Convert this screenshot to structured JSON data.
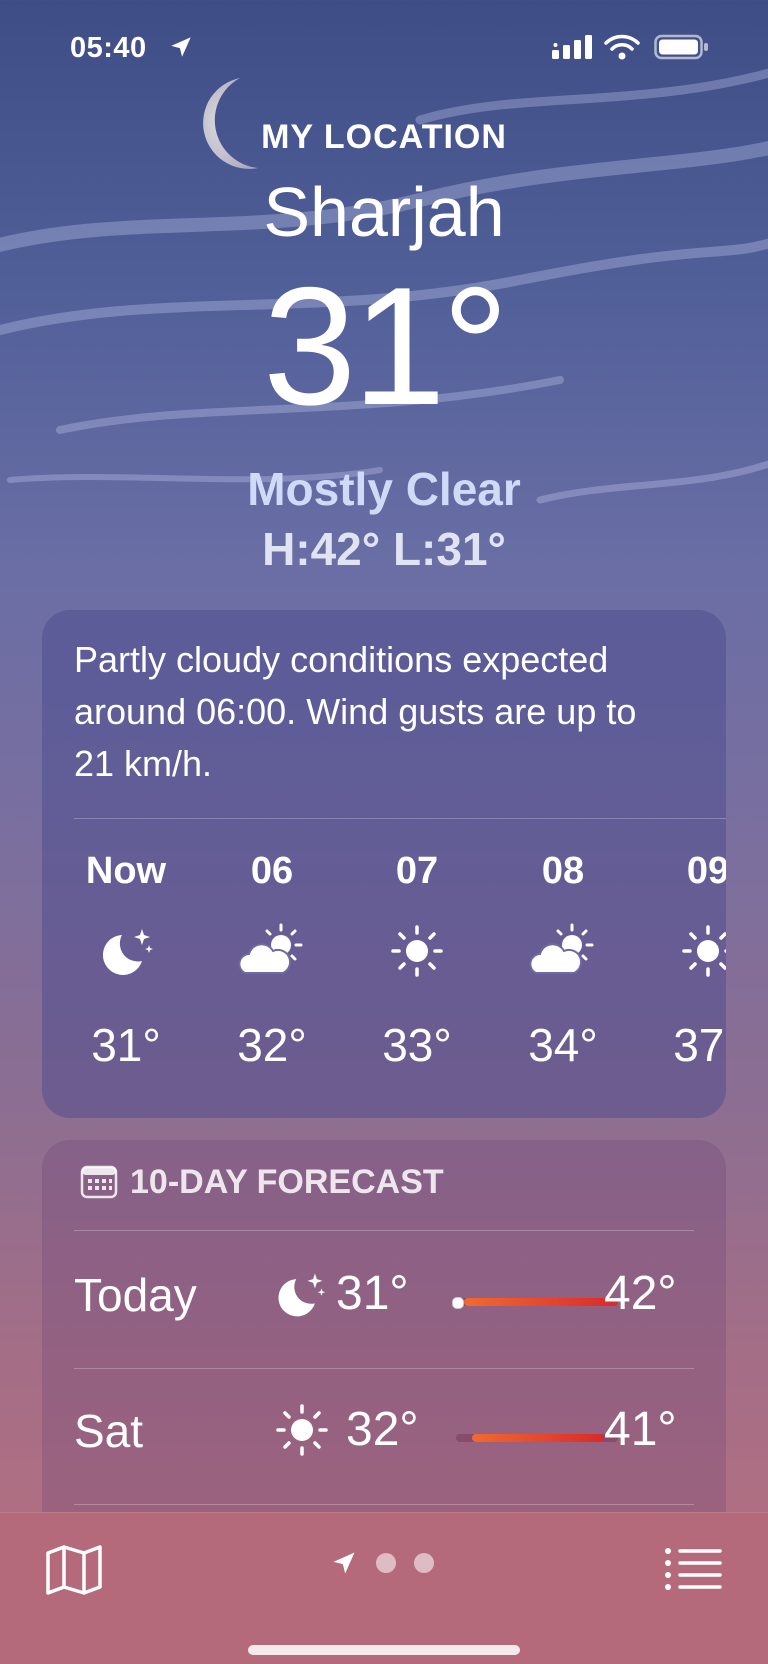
{
  "status_bar": {
    "time": "05:40"
  },
  "header": {
    "location_label": "MY LOCATION",
    "city": "Sharjah",
    "temperature": "31°",
    "condition": "Mostly Clear",
    "high_low": "H:42°  L:31°"
  },
  "hourly_card": {
    "summary": "Partly cloudy conditions expected around 06:00. Wind gusts are up to 21 km/h.",
    "hours": [
      {
        "label": "Now",
        "icon": "moon-stars-icon",
        "temp": "31°"
      },
      {
        "label": "06",
        "icon": "partly-cloudy-sun-icon",
        "temp": "32°"
      },
      {
        "label": "07",
        "icon": "sun-icon",
        "temp": "33°"
      },
      {
        "label": "08",
        "icon": "partly-cloudy-sun-icon",
        "temp": "34°"
      },
      {
        "label": "09",
        "icon": "sun-icon",
        "temp": "37°"
      }
    ]
  },
  "forecast_card": {
    "title": "10-DAY FORECAST",
    "days": [
      {
        "day": "Today",
        "icon": "moon-stars-icon",
        "low": "31°",
        "high": "42°"
      },
      {
        "day": "Sat",
        "icon": "sun-icon",
        "low": "32°",
        "high": "41°"
      }
    ]
  },
  "tab_bar": {
    "icons": [
      "map-icon",
      "location-arrow-icon",
      "list-icon"
    ]
  }
}
